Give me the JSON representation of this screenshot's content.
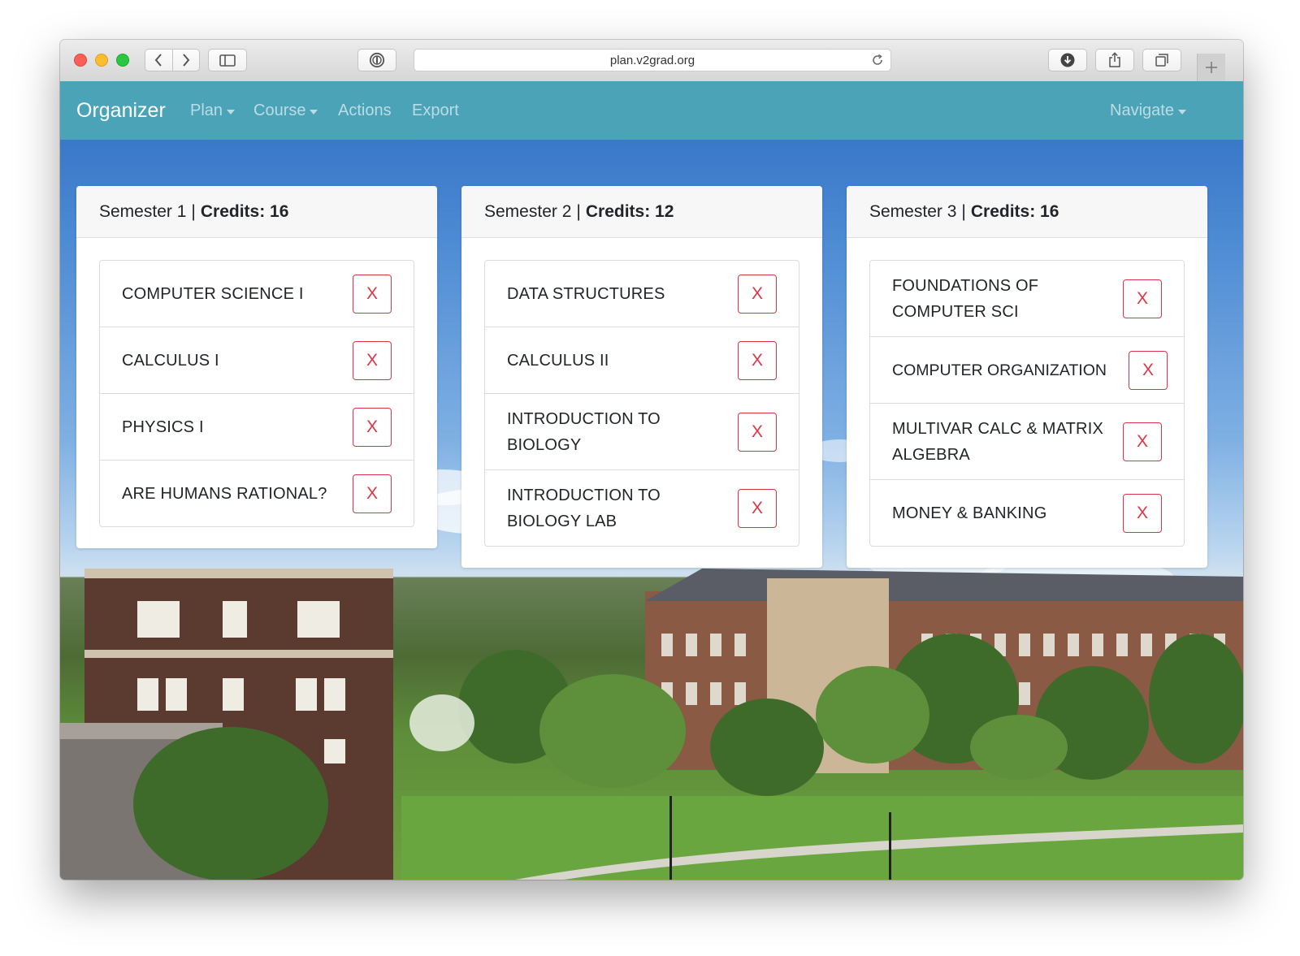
{
  "browser": {
    "url": "plan.v2grad.org"
  },
  "navbar": {
    "brand": "Organizer",
    "links": [
      {
        "label": "Plan",
        "dropdown": true
      },
      {
        "label": "Course",
        "dropdown": true
      },
      {
        "label": "Actions",
        "dropdown": false
      },
      {
        "label": "Export",
        "dropdown": false
      }
    ],
    "right_link": {
      "label": "Navigate",
      "dropdown": true
    },
    "color": "#4ba3b8"
  },
  "semesters": [
    {
      "title": "Semester 1",
      "separator": "|",
      "credits_label": "Credits: 16",
      "courses": [
        {
          "name": "COMPUTER SCIENCE I",
          "remove_label": "X"
        },
        {
          "name": "CALCULUS I",
          "remove_label": "X"
        },
        {
          "name": "PHYSICS I",
          "remove_label": "X"
        },
        {
          "name": "ARE HUMANS RATIONAL?",
          "remove_label": "X"
        }
      ]
    },
    {
      "title": "Semester 2",
      "separator": "|",
      "credits_label": "Credits: 12",
      "courses": [
        {
          "name": "DATA STRUCTURES",
          "remove_label": "X"
        },
        {
          "name": "CALCULUS II",
          "remove_label": "X"
        },
        {
          "name": "INTRODUCTION TO BIOLOGY",
          "remove_label": "X"
        },
        {
          "name": "INTRODUCTION TO BIOLOGY LAB",
          "remove_label": "X"
        }
      ]
    },
    {
      "title": "Semester 3",
      "separator": "|",
      "credits_label": "Credits: 16",
      "courses": [
        {
          "name": "FOUNDATIONS OF COMPUTER SCI",
          "remove_label": "X"
        },
        {
          "name": "COMPUTER ORGANIZATION",
          "remove_label": "X"
        },
        {
          "name": "MULTIVAR CALC & MATRIX ALGEBRA",
          "remove_label": "X"
        },
        {
          "name": "MONEY & BANKING",
          "remove_label": "X"
        }
      ]
    }
  ],
  "colors": {
    "remove_button": "#dc3545"
  }
}
